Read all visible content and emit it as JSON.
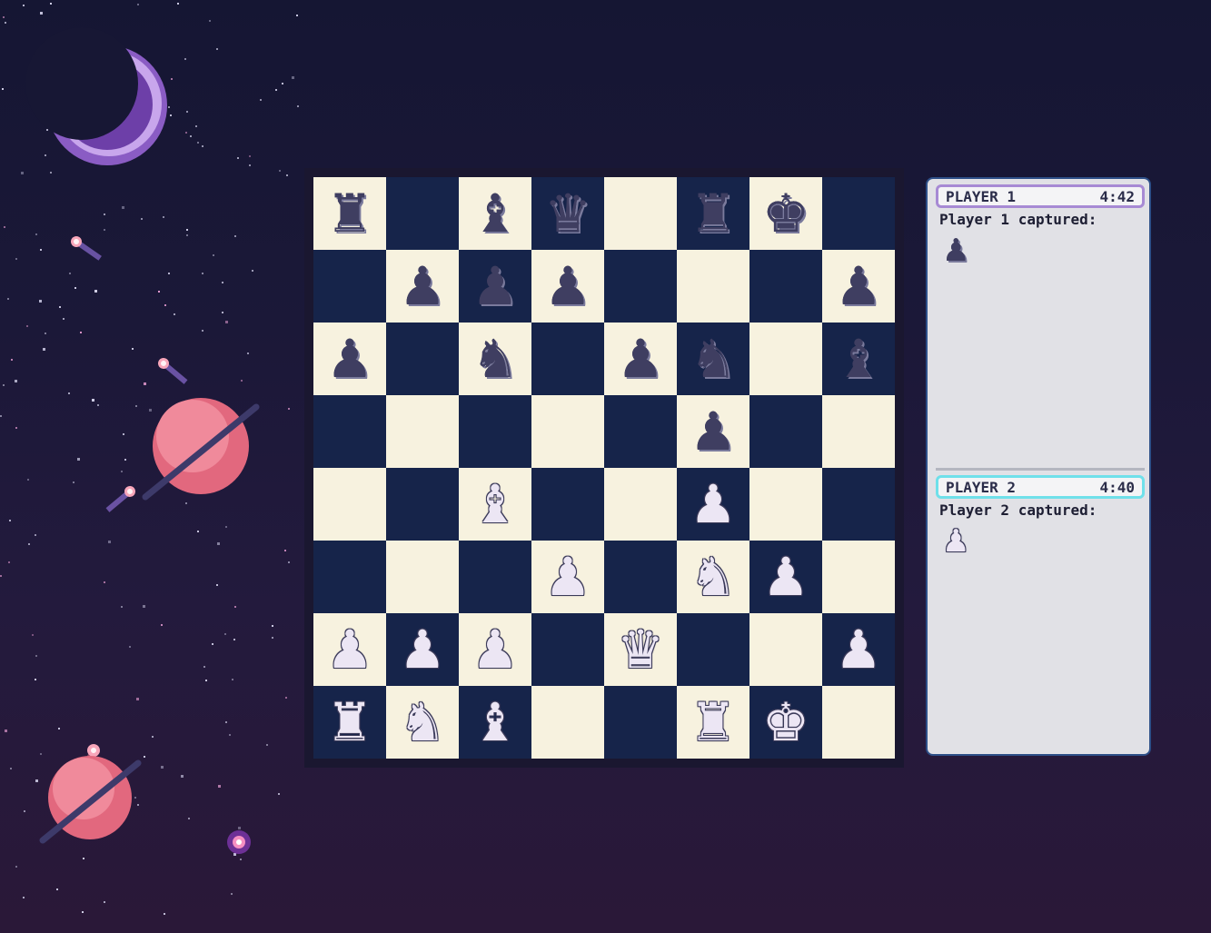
{
  "colors": {
    "light_square": "#f7f2df",
    "dark_square": "#16244a",
    "black_piece": "#3f3e61",
    "white_piece": "#ece6f4",
    "player1_accent": "#a78ad4",
    "player2_accent": "#6fe0ea"
  },
  "board": {
    "rows": [
      [
        "r",
        "",
        "b",
        "q",
        "",
        "r",
        "k",
        ""
      ],
      [
        "",
        "p",
        "p",
        "p",
        "",
        "",
        "",
        "p"
      ],
      [
        "p",
        "",
        "n",
        "",
        "p",
        "n",
        "",
        "b"
      ],
      [
        "",
        "",
        "",
        "",
        "",
        "p",
        "",
        ""
      ],
      [
        "",
        "",
        "B",
        "",
        "",
        "P",
        "",
        ""
      ],
      [
        "",
        "",
        "",
        "P",
        "",
        "N",
        "P",
        ""
      ],
      [
        "P",
        "P",
        "P",
        "",
        "Q",
        "",
        "",
        "P"
      ],
      [
        "R",
        "N",
        "B",
        "",
        "",
        "R",
        "K",
        ""
      ]
    ]
  },
  "players": [
    {
      "name": "PLAYER 1",
      "clock": "4:42",
      "captured_label": "Player 1 captured:",
      "captured": [
        "p"
      ]
    },
    {
      "name": "PLAYER 2",
      "clock": "4:40",
      "captured_label": "Player 2 captured:",
      "captured": [
        "P"
      ]
    }
  ],
  "icons": {
    "decor": [
      "moon-icon",
      "planet-icon",
      "comet-icon",
      "star-icon"
    ],
    "pieces": {
      "r": "black-rook-icon",
      "n": "black-knight-icon",
      "b": "black-bishop-icon",
      "q": "black-queen-icon",
      "k": "black-king-icon",
      "p": "black-pawn-icon",
      "R": "white-rook-icon",
      "N": "white-knight-icon",
      "B": "white-bishop-icon",
      "Q": "white-queen-icon",
      "K": "white-king-icon",
      "P": "white-pawn-icon"
    }
  }
}
